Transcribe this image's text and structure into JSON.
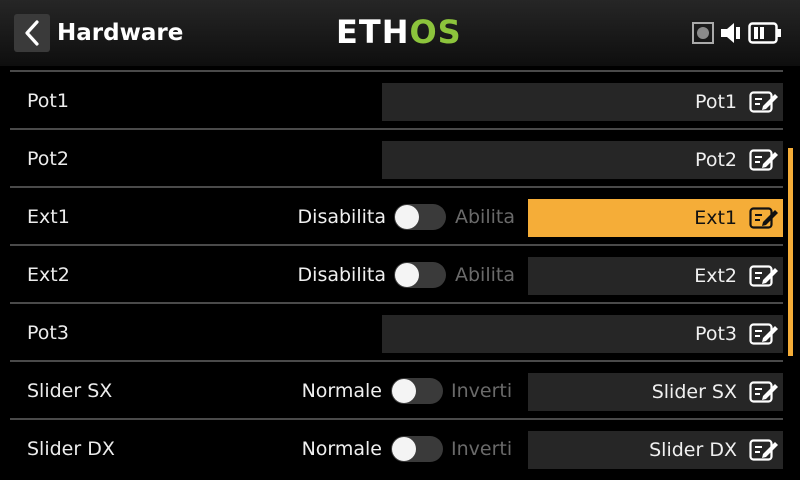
{
  "header": {
    "title": "Hardware",
    "logo_left": "ETH",
    "logo_right": "OS"
  },
  "rows": [
    {
      "label": "Pot1",
      "value": "Pot1"
    },
    {
      "label": "Pot2",
      "value": "Pot2"
    },
    {
      "label": "Ext1",
      "value": "Ext1",
      "toggle_off": "Disabilita",
      "toggle_on": "Abilita",
      "active": true
    },
    {
      "label": "Ext2",
      "value": "Ext2",
      "toggle_off": "Disabilita",
      "toggle_on": "Abilita"
    },
    {
      "label": "Pot3",
      "value": "Pot3"
    },
    {
      "label": "Slider SX",
      "value": "Slider SX",
      "toggle_off": "Normale",
      "toggle_on": "Inverti"
    },
    {
      "label": "Slider DX",
      "value": "Slider DX",
      "toggle_off": "Normale",
      "toggle_on": "Inverti"
    }
  ],
  "colors": {
    "accent": "#f5ad38",
    "logo_green": "#8cc43c"
  },
  "icons": {
    "back": "chevron-left-icon",
    "edit": "edit-icon",
    "status": [
      "record-icon",
      "speaker-icon",
      "battery-icon"
    ]
  }
}
